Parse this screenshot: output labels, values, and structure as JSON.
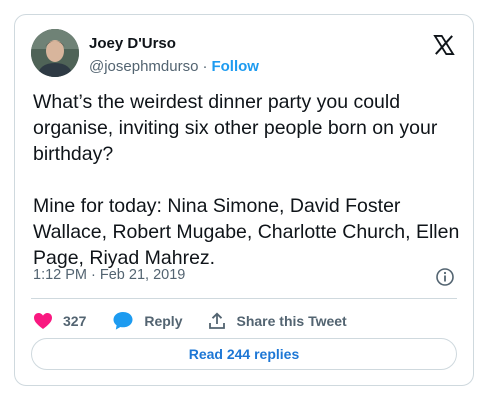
{
  "author": {
    "name": "Joey D'Urso",
    "handle": "@josephmdurso",
    "separator": "·",
    "follow_label": "Follow"
  },
  "tweet": {
    "text": "What’s the weirdest dinner party you could organise, inviting six other people born on your birthday?\n\nMine for today: Nina Simone, David Foster Wallace, Robert Mugabe, Charlotte Church, Ellen Page, Riyad Mahrez.",
    "timestamp": "1:12 PM · Feb 21, 2019"
  },
  "actions": {
    "likes_count": "327",
    "reply_label": "Reply",
    "share_label": "Share this Tweet"
  },
  "read_replies_label": "Read 244 replies",
  "colors": {
    "accent": "#1d9bf0",
    "like": "#f91880",
    "reply_icon": "#1d9bf0",
    "text_secondary": "#536471"
  },
  "icons": {
    "brand": "x-logo-icon",
    "info": "info-icon",
    "like": "heart-icon",
    "reply": "speech-bubble-icon",
    "share": "share-upload-icon"
  }
}
